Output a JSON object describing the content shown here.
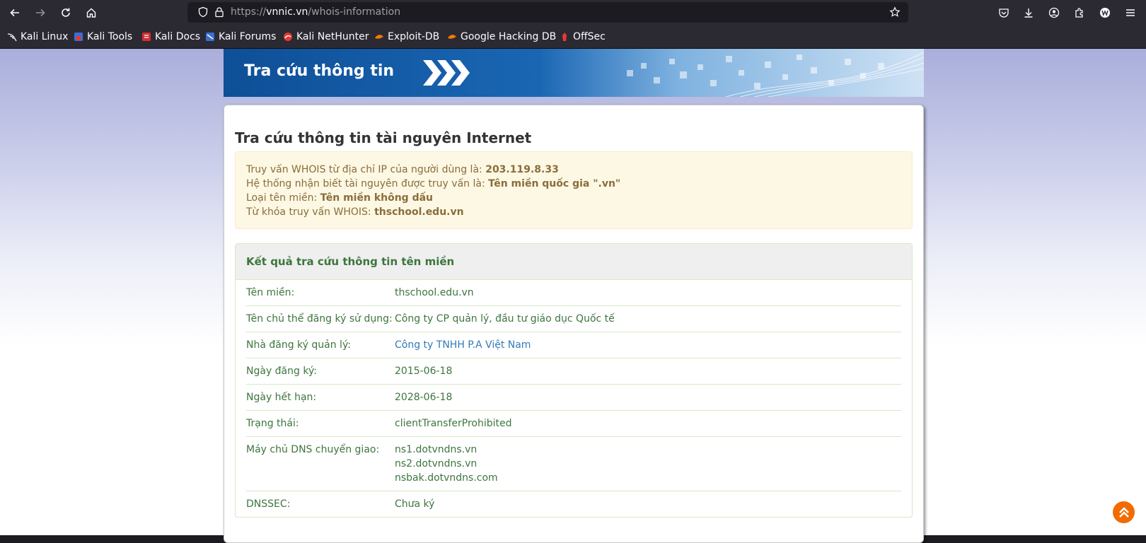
{
  "browser": {
    "url_prefix": "https://",
    "url_host": "vnnic.vn",
    "url_path": "/whois-information",
    "bookmarks": [
      {
        "label": "Kali Linux",
        "icon": "kali-dragon-icon"
      },
      {
        "label": "Kali Tools",
        "icon": "kali-tools-icon"
      },
      {
        "label": "Kali Docs",
        "icon": "kali-docs-icon"
      },
      {
        "label": "Kali Forums",
        "icon": "kali-forums-icon"
      },
      {
        "label": "Kali NetHunter",
        "icon": "kali-nethunter-icon"
      },
      {
        "label": "Exploit-DB",
        "icon": "exploit-db-icon"
      },
      {
        "label": "Google Hacking DB",
        "icon": "ghdb-icon"
      },
      {
        "label": "OffSec",
        "icon": "offsec-icon"
      }
    ]
  },
  "banner": {
    "title": "Tra cứu thông tin"
  },
  "main": {
    "title": "Tra cứu thông tin tài nguyên Internet",
    "info": [
      {
        "label": "Truy vấn WHOIS từ địa chỉ IP của người dùng là: ",
        "value": "203.119.8.33"
      },
      {
        "label": "Hệ thống nhận biết tài nguyên được truy vấn là: ",
        "value": "Tên miền quốc gia \".vn\""
      },
      {
        "label": "Loại tên miền: ",
        "value": "Tên miền không dấu"
      },
      {
        "label": "Từ khóa truy vấn WHOIS: ",
        "value": "thschool.edu.vn"
      }
    ],
    "result": {
      "heading": "Kết quả tra cứu thông tin tên miền",
      "rows": [
        {
          "key": "Tên miền:",
          "value": "thschool.edu.vn"
        },
        {
          "key": "Tên chủ thể đăng ký sử dụng:",
          "value": "Công ty CP quản lý, đầu tư giáo dục Quốc tế"
        },
        {
          "key": "Nhà đăng ký quản lý:",
          "value": "Công ty TNHH P.A Việt Nam"
        },
        {
          "key": "Ngày đăng ký:",
          "value": "2015-06-18"
        },
        {
          "key": "Ngày hết hạn:",
          "value": "2028-06-18"
        },
        {
          "key": "Trạng thái:",
          "value": "clientTransferProhibited"
        },
        {
          "key": "Máy chủ DNS chuyển giao:",
          "values": [
            "ns1.dotvndns.vn",
            "ns2.dotvndns.vn",
            "nsbak.dotvndns.com"
          ]
        },
        {
          "key": "DNSSEC:",
          "value": "Chưa ký"
        }
      ]
    }
  }
}
